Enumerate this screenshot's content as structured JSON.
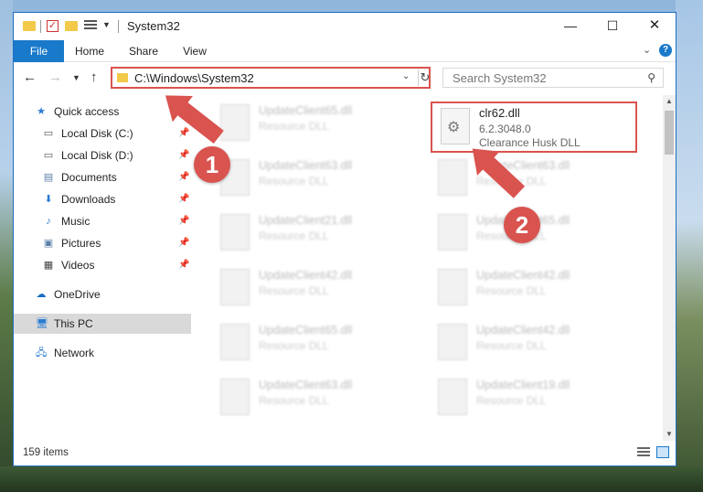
{
  "window": {
    "title": "System32",
    "controls": {
      "minimize": "—",
      "maximize": "☐",
      "close": "✕"
    }
  },
  "ribbon": {
    "tabs": [
      "File",
      "Home",
      "Share",
      "View"
    ]
  },
  "navigation": {
    "address": "C:\\Windows\\System32",
    "search_placeholder": "Search System32"
  },
  "sidebar": {
    "items": [
      {
        "label": "Quick access",
        "icon": "star-icon",
        "pinned": false
      },
      {
        "label": "Local Disk (C:)",
        "icon": "drive-icon",
        "pinned": true
      },
      {
        "label": "Local Disk (D:)",
        "icon": "drive-icon",
        "pinned": true
      },
      {
        "label": "Documents",
        "icon": "documents-icon",
        "pinned": true
      },
      {
        "label": "Downloads",
        "icon": "download-icon",
        "pinned": true
      },
      {
        "label": "Music",
        "icon": "music-icon",
        "pinned": true
      },
      {
        "label": "Pictures",
        "icon": "pictures-icon",
        "pinned": true
      },
      {
        "label": "Videos",
        "icon": "videos-icon",
        "pinned": true
      },
      {
        "label": "OneDrive",
        "icon": "cloud-icon",
        "pinned": false
      },
      {
        "label": "This PC",
        "icon": "computer-icon",
        "pinned": false,
        "selected": true
      },
      {
        "label": "Network",
        "icon": "network-icon",
        "pinned": false
      }
    ]
  },
  "files": {
    "highlighted": {
      "name": "clr62.dll",
      "version": "6.2.3048.0",
      "description": "Clearance Husk DLL"
    },
    "left_column": [
      {
        "name": "UpdateClient65.dll",
        "description": "Resource DLL"
      },
      {
        "name": "UpdateClient63.dll",
        "description": "Resource DLL"
      },
      {
        "name": "UpdateClient21.dll",
        "description": "Resource DLL"
      },
      {
        "name": "UpdateClient42.dll",
        "description": "Resource DLL"
      },
      {
        "name": "UpdateClient65.dll",
        "description": "Resource DLL"
      },
      {
        "name": "UpdateClient63.dll",
        "description": "Resource DLL"
      }
    ],
    "right_column": [
      {
        "name": "UpdateClient63.dll",
        "description": "Resource DLL"
      },
      {
        "name": "UpdateClient65.dll",
        "description": "Resource DLL"
      },
      {
        "name": "UpdateClient42.dll",
        "description": "Resource DLL"
      },
      {
        "name": "UpdateClient42.dll",
        "description": "Resource DLL"
      },
      {
        "name": "UpdateClient19.dll",
        "description": "Resource DLL"
      }
    ]
  },
  "status": {
    "item_count": "159 items"
  },
  "annotations": {
    "step1": "1",
    "step2": "2",
    "color": "#d9534f"
  }
}
